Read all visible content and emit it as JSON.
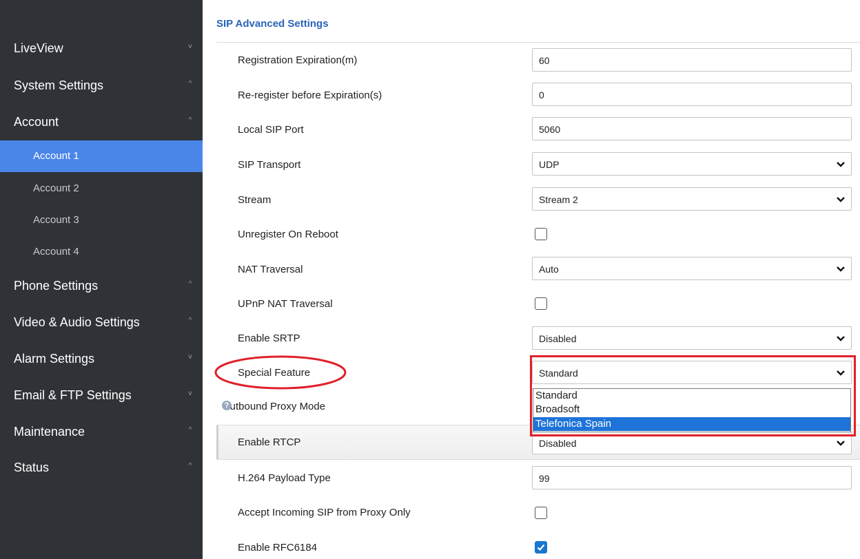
{
  "sidebar": {
    "items": [
      {
        "label": "LiveView",
        "chevron": "v"
      },
      {
        "label": "System Settings",
        "chevron": "^"
      },
      {
        "label": "Account",
        "chevron": "^"
      },
      {
        "label": "Phone Settings",
        "chevron": "^"
      },
      {
        "label": "Video & Audio Settings",
        "chevron": "^"
      },
      {
        "label": "Alarm Settings",
        "chevron": "v"
      },
      {
        "label": "Email & FTP Settings",
        "chevron": "v"
      },
      {
        "label": "Maintenance",
        "chevron": "^"
      },
      {
        "label": "Status",
        "chevron": "^"
      }
    ],
    "account_sub": [
      {
        "label": "Account 1",
        "active": true
      },
      {
        "label": "Account 2",
        "active": false
      },
      {
        "label": "Account 3",
        "active": false
      },
      {
        "label": "Account 4",
        "active": false
      }
    ],
    "active_color": "#4a86e8"
  },
  "main": {
    "section_title": "SIP Advanced Settings",
    "rows": {
      "registration_expiration": {
        "label": "Registration Expiration(m)",
        "value": "60"
      },
      "reregister": {
        "label": "Re-register before Expiration(s)",
        "value": "0"
      },
      "local_sip_port": {
        "label": "Local SIP Port",
        "value": "5060"
      },
      "sip_transport": {
        "label": "SIP Transport",
        "value": "UDP"
      },
      "stream": {
        "label": "Stream",
        "value": "Stream 2"
      },
      "unregister_on_reboot": {
        "label": "Unregister On Reboot",
        "checked": false
      },
      "nat_traversal": {
        "label": "NAT Traversal",
        "value": "Auto"
      },
      "upnp_nat": {
        "label": "UPnP NAT Traversal",
        "checked": false
      },
      "enable_srtp": {
        "label": "Enable SRTP",
        "value": "Disabled"
      },
      "special_feature": {
        "label": "Special Feature",
        "value": "Standard"
      },
      "outbound_proxy_mode": {
        "label": "Outbound Proxy Mode"
      },
      "enable_rtcp": {
        "label": "Enable RTCP",
        "value": "Disabled"
      },
      "h264_payload": {
        "label": "H.264 Payload Type",
        "value": "99"
      },
      "accept_incoming": {
        "label": "Accept Incoming SIP from Proxy Only",
        "checked": false
      },
      "enable_rfc6184": {
        "label": "Enable RFC6184",
        "checked": true
      }
    },
    "special_feature_options": [
      {
        "label": "Standard",
        "selected": false
      },
      {
        "label": "Broadsoft",
        "selected": false
      },
      {
        "label": "Telefonica Spain",
        "selected": true
      }
    ],
    "help_icon_glyph": "?",
    "annotation_color": "#e0202a",
    "title_color": "#2a63b8"
  }
}
